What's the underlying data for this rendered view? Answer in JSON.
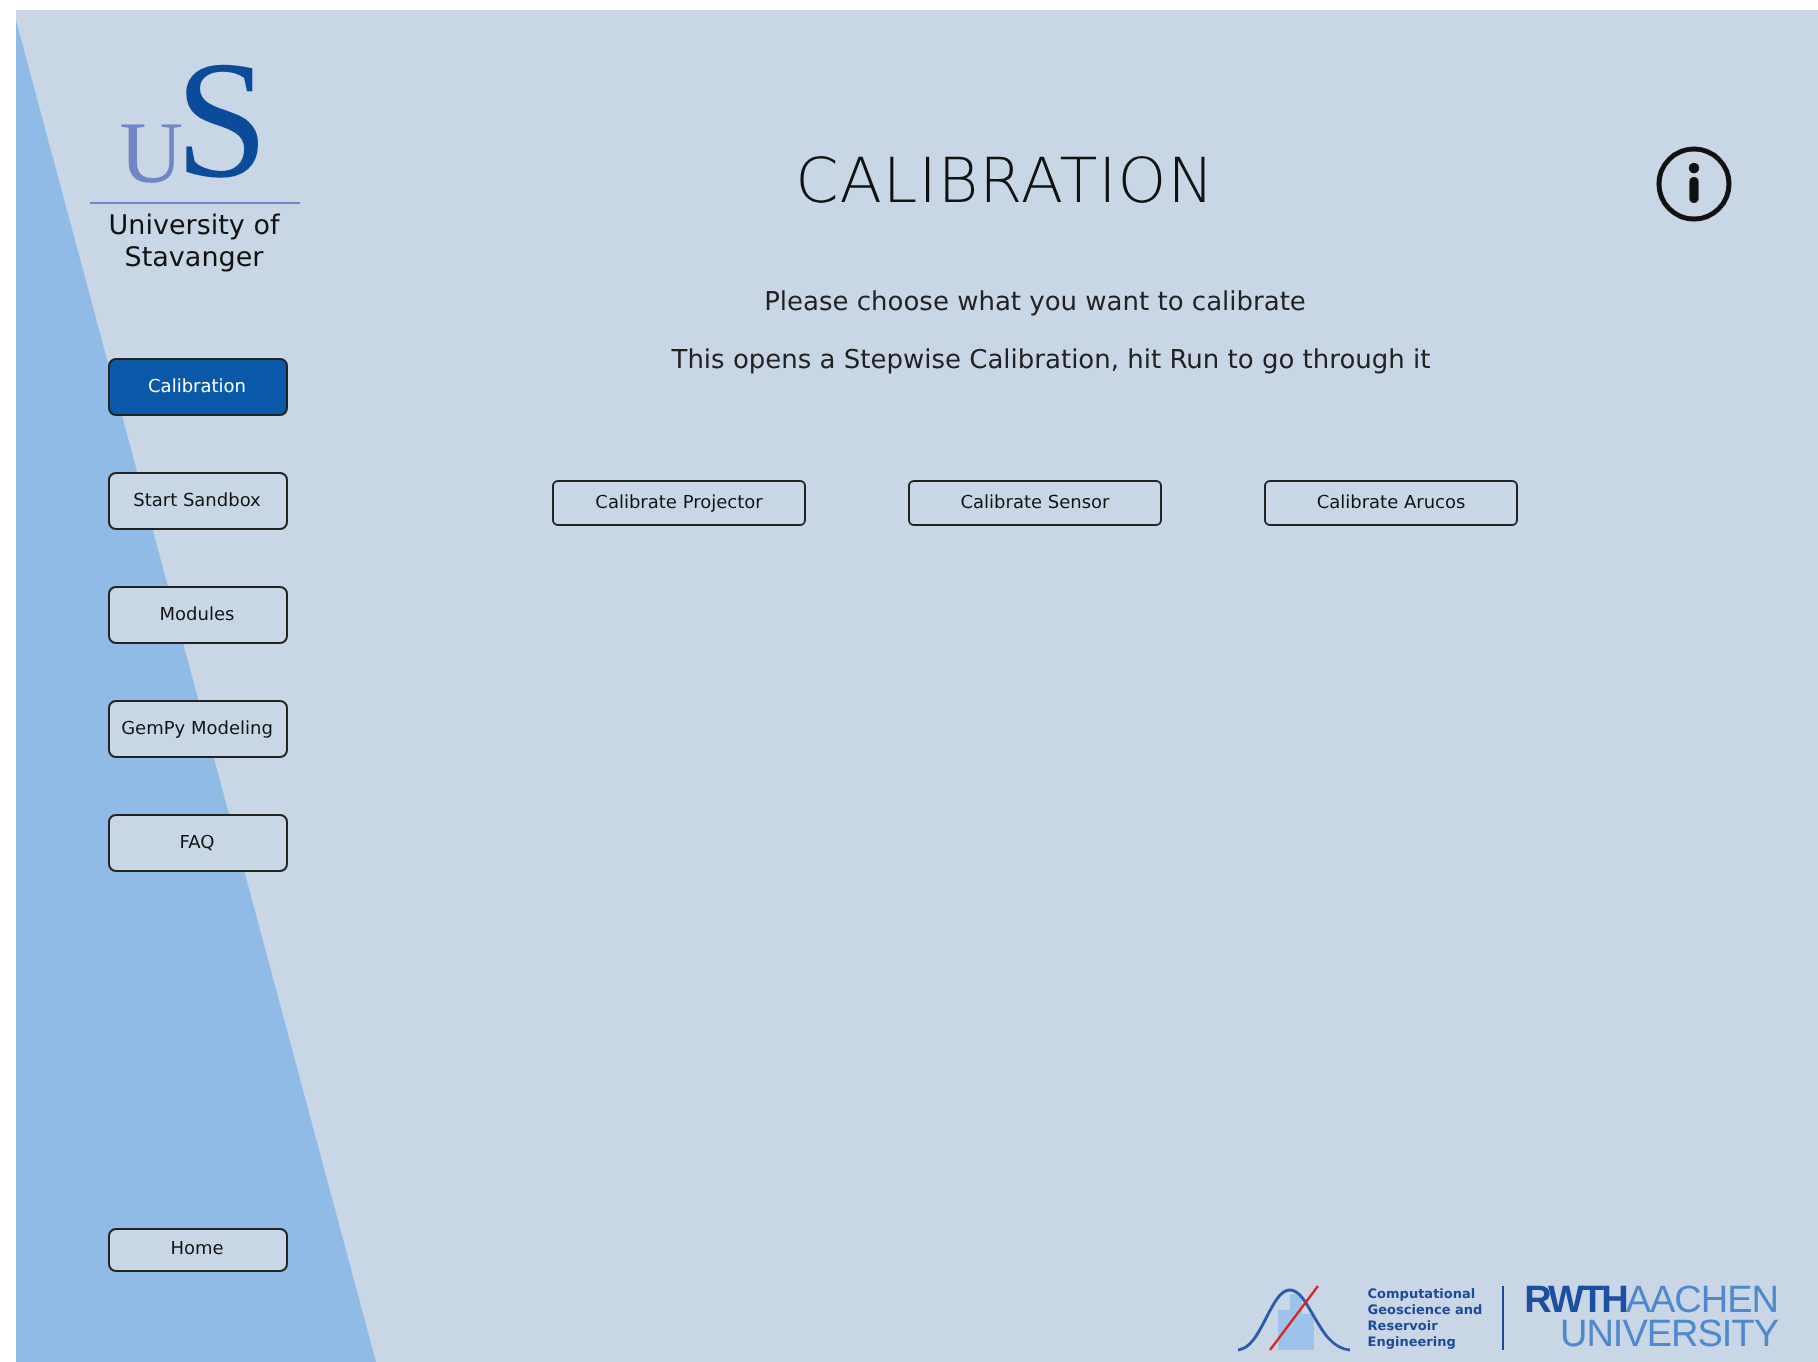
{
  "logo": {
    "mark_large": "S",
    "mark_small": "U",
    "name_lines": [
      "University of",
      "Stavanger"
    ]
  },
  "nav": [
    {
      "label": "Calibration",
      "selected": true
    },
    {
      "label": "Start Sandbox",
      "selected": false
    },
    {
      "label": "Modules",
      "selected": false
    },
    {
      "label": "GemPy Modeling",
      "selected": false
    },
    {
      "label": "FAQ",
      "selected": false
    }
  ],
  "home_button": "Home",
  "title": "CALIBRATION",
  "instructions": [
    "Please choose what you want to calibrate",
    "This opens a Stepwise Calibration, hit Run to go through it"
  ],
  "actions": [
    "Calibrate Projector",
    "Calibrate Sensor",
    "Calibrate Arucos"
  ],
  "footer": {
    "group_lines": [
      "Computational",
      "Geoscience and",
      "Reservoir",
      "Engineering"
    ],
    "university_word": "RWTH",
    "city": "AACHEN",
    "university_line": "UNIVERSITY"
  }
}
